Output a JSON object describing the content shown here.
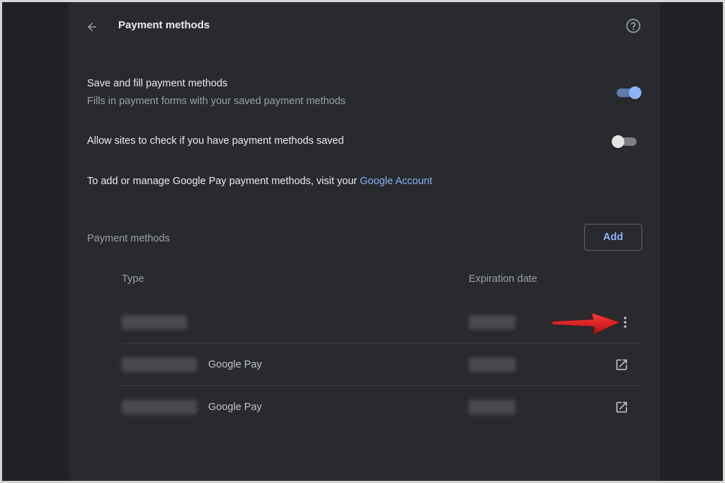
{
  "header": {
    "title": "Payment methods",
    "back_icon": "arrow-left-icon",
    "help_icon": "help-circle-icon"
  },
  "settings": {
    "save_fill": {
      "title": "Save and fill payment methods",
      "subtitle": "Fills in payment forms with your saved payment methods",
      "enabled": true
    },
    "allow_check": {
      "title": "Allow sites to check if you have payment methods saved",
      "enabled": false
    }
  },
  "info": {
    "text": "To add or manage Google Pay payment methods, visit your ",
    "link": "Google Account"
  },
  "payment_methods": {
    "section_title": "Payment methods",
    "add_label": "Add",
    "columns": {
      "type": "Type",
      "expiration": "Expiration date"
    },
    "rows": [
      {
        "card": "•••• ••••",
        "source": "",
        "expiration": "••/••••",
        "action_icon": "more-vert-icon"
      },
      {
        "card": "•••• ••••",
        "source": "Google Pay",
        "expiration": "••/••••",
        "action_icon": "open-external-icon"
      },
      {
        "card": "•••• ••••",
        "source": "Google Pay",
        "expiration": "••/••••",
        "action_icon": "open-external-icon"
      }
    ]
  },
  "colors": {
    "background": "#202124",
    "card": "#292a2d",
    "accent": "#8ab4f8",
    "annotation_arrow": "#e01e1e"
  }
}
